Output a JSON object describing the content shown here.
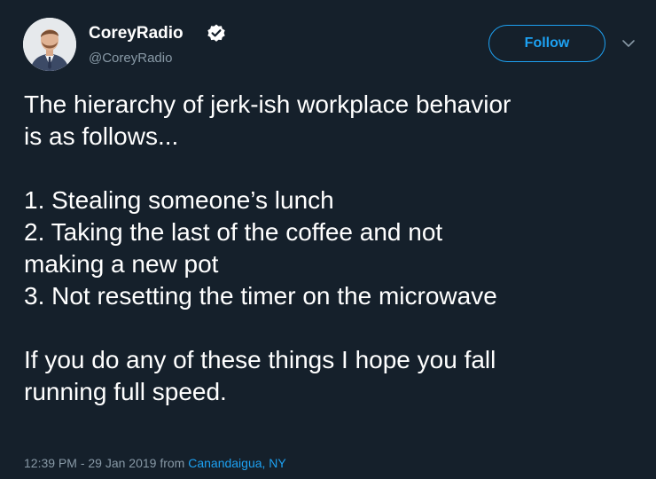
{
  "user": {
    "display_name": "CoreyRadio",
    "handle": "@CoreyRadio",
    "verified": true
  },
  "actions": {
    "follow_label": "Follow"
  },
  "tweet": {
    "lines": [
      "The hierarchy of jerk-ish workplace behavior",
      "is as follows...",
      "",
      "1. Stealing someone’s lunch",
      "2. Taking the last of the coffee and not",
      "making a new pot",
      "3. Not resetting the timer on the microwave",
      "",
      "If you do any of these things I hope you fall",
      "running full speed."
    ]
  },
  "meta": {
    "timestamp": "12:39 PM - 29 Jan 2019 from ",
    "location": "Canandaigua, NY"
  },
  "colors": {
    "background": "#15202b",
    "text": "#ffffff",
    "secondary": "#8899a6",
    "accent": "#1da1f2"
  },
  "icons": {
    "verified": "verified-badge-icon",
    "caret": "chevron-down-icon"
  }
}
